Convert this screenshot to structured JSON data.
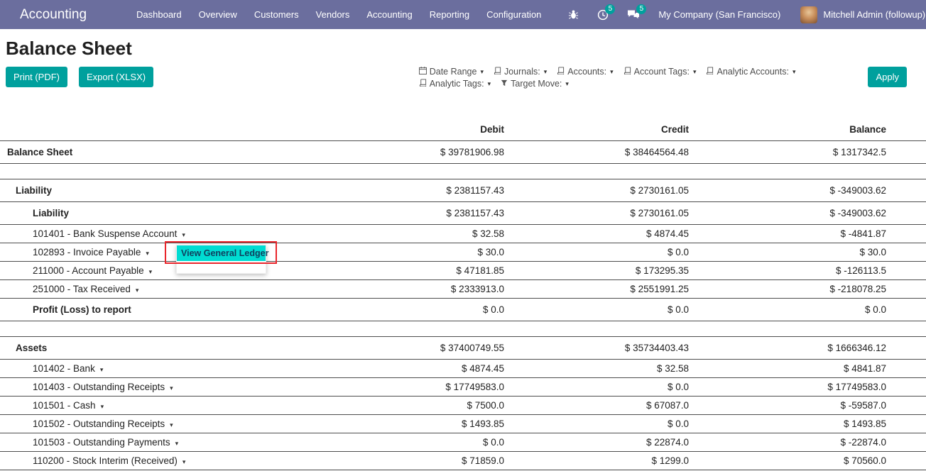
{
  "topbar": {
    "app_name": "Accounting",
    "menu_items": [
      "Dashboard",
      "Overview",
      "Customers",
      "Vendors",
      "Accounting",
      "Reporting",
      "Configuration"
    ],
    "activity_badge": "5",
    "message_badge": "5",
    "company": "My Company (San Francisco)",
    "user": "Mitchell Admin (followup)"
  },
  "page_title": "Balance Sheet",
  "toolbar": {
    "print": "Print (PDF)",
    "export": "Export (XLSX)",
    "apply": "Apply"
  },
  "filters": {
    "row1": [
      {
        "icon": "calendar-icon",
        "label": "Date Range"
      },
      {
        "icon": "book-icon",
        "label": "Journals:"
      },
      {
        "icon": "book-icon",
        "label": "Accounts:"
      },
      {
        "icon": "book-icon",
        "label": "Account Tags:"
      },
      {
        "icon": "book-icon",
        "label": "Analytic Accounts:"
      }
    ],
    "row2": [
      {
        "icon": "book-icon",
        "label": "Analytic Tags:"
      },
      {
        "icon": "filter-icon",
        "label": "Target Move:"
      }
    ]
  },
  "table": {
    "headers": {
      "debit": "Debit",
      "credit": "Credit",
      "balance": "Balance"
    },
    "rows": [
      {
        "label": "Balance Sheet",
        "debit": "$ 39781906.98",
        "credit": "$ 38464564.48",
        "balance": "$ 1317342.5",
        "level": 0,
        "bold": true
      },
      {
        "spacer": true
      },
      {
        "label": "Liability",
        "debit": "$ 2381157.43",
        "credit": "$ 2730161.05",
        "balance": "$ -349003.62",
        "level": 1,
        "bold": true
      },
      {
        "label": "Liability",
        "debit": "$ 2381157.43",
        "credit": "$ 2730161.05",
        "balance": "$ -349003.62",
        "level": 2,
        "bold": true
      },
      {
        "label": "101401 - Bank Suspense Account",
        "debit": "$ 32.58",
        "credit": "$ 4874.45",
        "balance": "$ -4841.87",
        "level": 2,
        "dropdown": true
      },
      {
        "label": "102893 - Invoice Payable",
        "debit": "$ 30.0",
        "credit": "$ 0.0",
        "balance": "$ 30.0",
        "level": 2,
        "dropdown": true,
        "open": true
      },
      {
        "label": "211000 - Account Payable",
        "debit": "$ 47181.85",
        "credit": "$ 173295.35",
        "balance": "$ -126113.5",
        "level": 2,
        "dropdown": true
      },
      {
        "label": "251000 - Tax Received",
        "debit": "$ 2333913.0",
        "credit": "$ 2551991.25",
        "balance": "$ -218078.25",
        "level": 2,
        "dropdown": true
      },
      {
        "label": "Profit (Loss) to report",
        "debit": "$ 0.0",
        "credit": "$ 0.0",
        "balance": "$ 0.0",
        "level": 2,
        "bold": true
      },
      {
        "spacer": true
      },
      {
        "label": "Assets",
        "debit": "$ 37400749.55",
        "credit": "$ 35734403.43",
        "balance": "$ 1666346.12",
        "level": 1,
        "bold": true
      },
      {
        "label": "101402 - Bank",
        "debit": "$ 4874.45",
        "credit": "$ 32.58",
        "balance": "$ 4841.87",
        "level": 2,
        "dropdown": true
      },
      {
        "label": "101403 - Outstanding Receipts",
        "debit": "$ 17749583.0",
        "credit": "$ 0.0",
        "balance": "$ 17749583.0",
        "level": 2,
        "dropdown": true
      },
      {
        "label": "101501 - Cash",
        "debit": "$ 7500.0",
        "credit": "$ 67087.0",
        "balance": "$ -59587.0",
        "level": 2,
        "dropdown": true
      },
      {
        "label": "101502 - Outstanding Receipts",
        "debit": "$ 1493.85",
        "credit": "$ 0.0",
        "balance": "$ 1493.85",
        "level": 2,
        "dropdown": true
      },
      {
        "label": "101503 - Outstanding Payments",
        "debit": "$ 0.0",
        "credit": "$ 22874.0",
        "balance": "$ -22874.0",
        "level": 2,
        "dropdown": true
      },
      {
        "label": "110200 - Stock Interim (Received)",
        "debit": "$ 71859.0",
        "credit": "$ 1299.0",
        "balance": "$ 70560.0",
        "level": 2,
        "dropdown": true
      }
    ]
  },
  "dropdown_menu": {
    "highlighted_item": "View General Ledger"
  },
  "colors": {
    "topbar": "#6b6e9e",
    "accent": "#00a09d",
    "badge": "#00a09d",
    "highlight": "#00dcd2",
    "annotation": "#e9252b"
  }
}
